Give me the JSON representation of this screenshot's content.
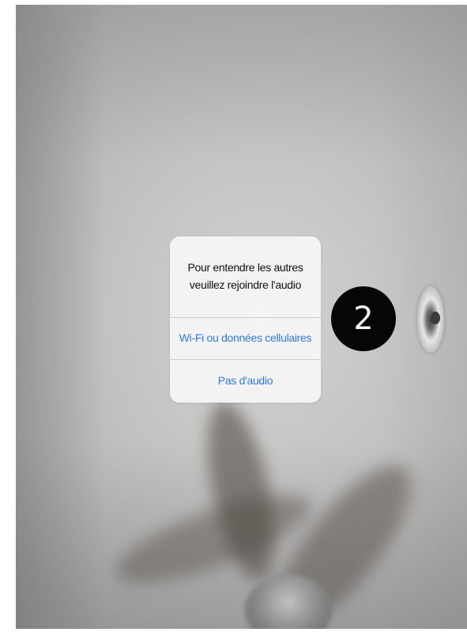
{
  "alert": {
    "message_line1": "Pour entendre les autres",
    "message_line2": "veuillez rejoindre l'audio",
    "option_wifi": "Wi-Fi ou données cellulaires",
    "option_no_audio": "Pas d'audio"
  },
  "annotation": {
    "step_number": "2"
  },
  "colors": {
    "action_blue": "#2f7ae5",
    "badge_black": "#060606",
    "alert_background": "#f5f5f5"
  }
}
